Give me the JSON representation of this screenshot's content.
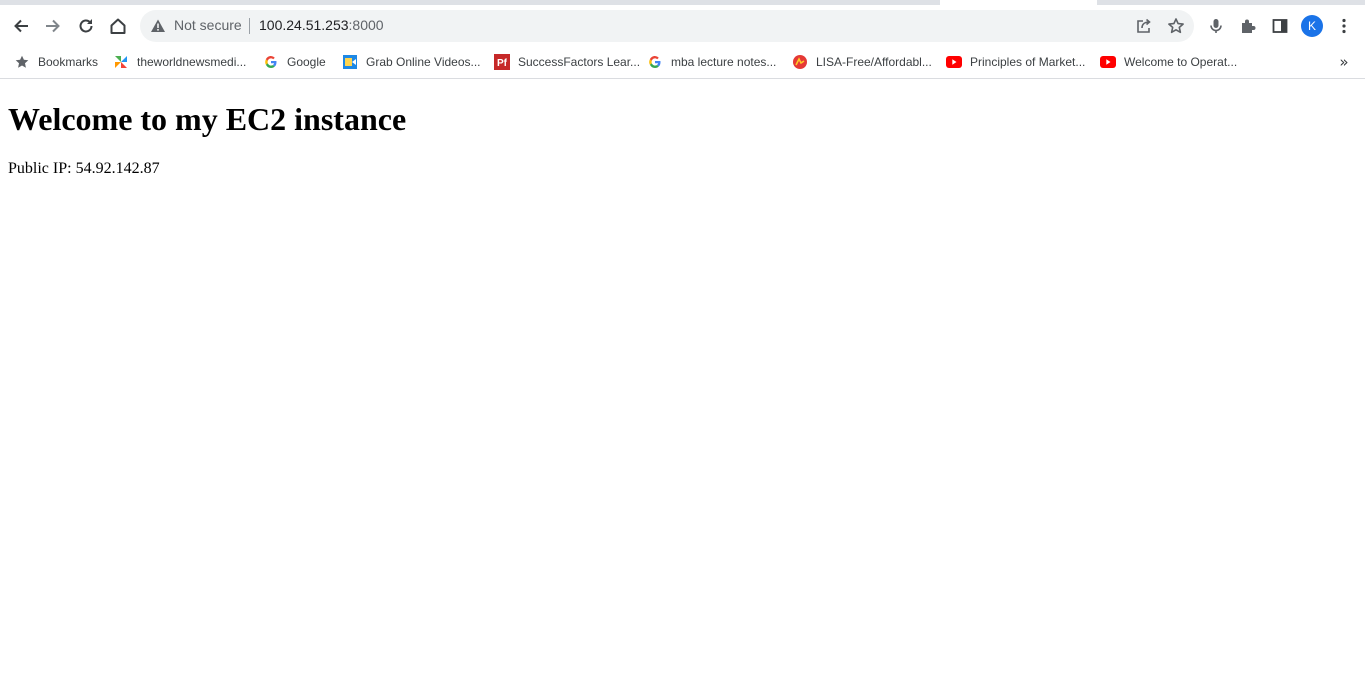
{
  "browser": {
    "address_bar": {
      "security_text": "Not secure",
      "host": "100.24.51.253",
      "port": ":8000"
    },
    "profile_initial": "K",
    "toolbar_icons": [
      "back-icon",
      "forward-icon",
      "reload-icon",
      "home-icon",
      "share-icon",
      "star-icon",
      "microphone-icon",
      "extensions-icon",
      "side-panel-icon",
      "more-menu-icon"
    ],
    "colors": {
      "avatar": "#1a73e8",
      "omnibox_bg": "#f1f3f4",
      "youtube_red": "#ff0000"
    }
  },
  "bookmarks": {
    "items": [
      {
        "label": "Bookmarks",
        "icon": "star-icon"
      },
      {
        "label": "theworldnewsmedi...",
        "icon": "pinwheel-icon"
      },
      {
        "label": "Google",
        "icon": "google-icon"
      },
      {
        "label": "Grab Online Videos...",
        "icon": "video-grab-icon"
      },
      {
        "label": "SuccessFactors Lear...",
        "icon": "pf-icon"
      },
      {
        "label": "mba lecture notes...",
        "icon": "google-icon"
      },
      {
        "label": "LISA-Free/Affordabl...",
        "icon": "lisa-icon"
      },
      {
        "label": "Principles of Market...",
        "icon": "youtube-icon"
      },
      {
        "label": "Welcome to Operat...",
        "icon": "youtube-icon"
      }
    ],
    "overflow_label": "»"
  },
  "page": {
    "heading": "Welcome to my EC2 instance",
    "public_ip_text": "Public IP: 54.92.142.87"
  }
}
